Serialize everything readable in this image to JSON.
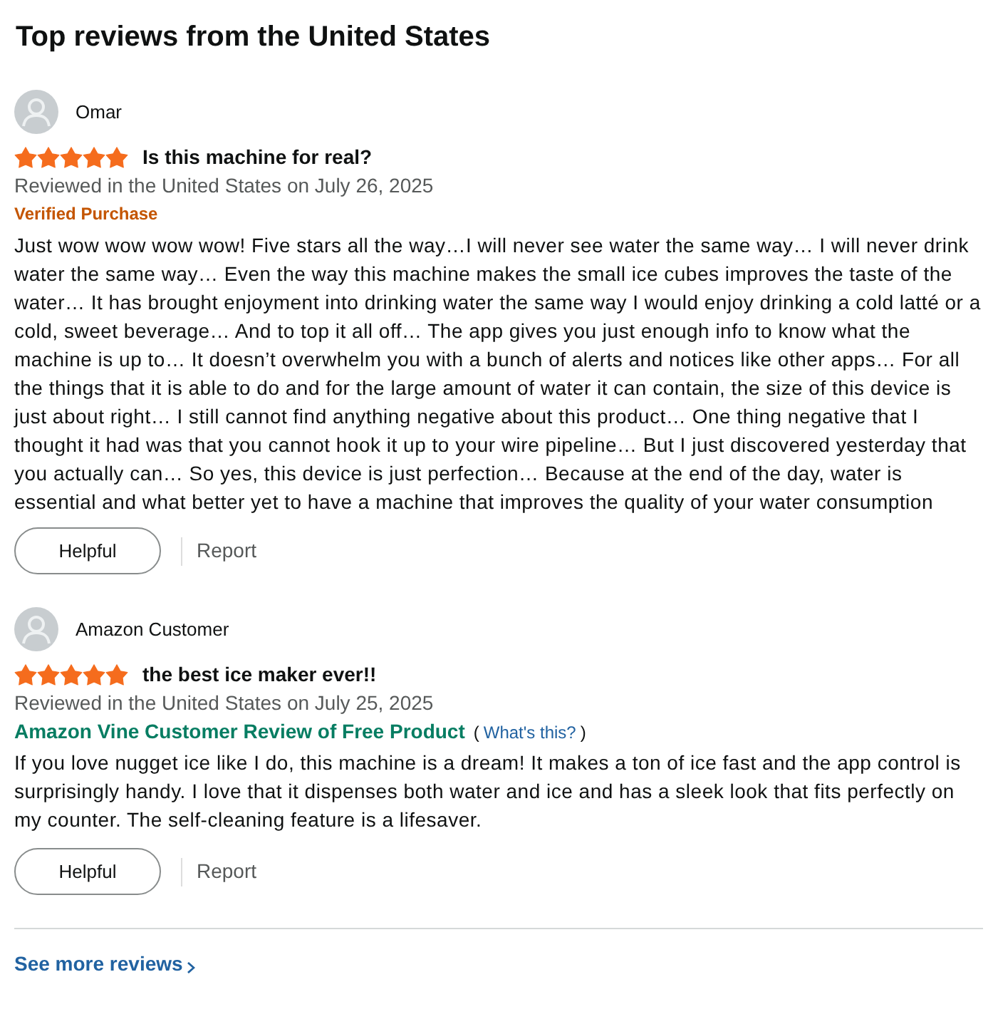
{
  "heading": "Top reviews from the United States",
  "reviews": [
    {
      "author": "Omar",
      "stars": 5,
      "title": "Is this machine for real?",
      "date_line": "Reviewed in the United States on July 26, 2025",
      "badge": {
        "kind": "verified",
        "text": "Verified Purchase"
      },
      "body": "Just wow wow wow wow! Five stars all the way…I will never see water the same way… I will never drink water the same way… Even the way this machine makes the small ice cubes improves the taste of the water… It has brought enjoyment into drinking water the same way I would enjoy drinking a cold latté or a cold, sweet beverage… And to top it all off… The app gives you just enough info to know what the machine is up to… It doesn’t overwhelm you with a bunch of alerts and notices like other apps… For all the things that it is able to do and for the large amount of water it can contain, the size of this device is just about right… I still cannot find anything negative about this product… One thing negative that I thought it had was that you cannot hook it up to your wire pipeline… But I just discovered yesterday that you actually can… So yes, this device is just perfection… Because at the end of the day, water is essential and what better yet to have a machine that improves the quality of your water consumption",
      "helpful_button": "Helpful",
      "report_link": "Report"
    },
    {
      "author": "Amazon Customer",
      "stars": 5,
      "title": "the best ice maker ever!!",
      "date_line": "Reviewed in the United States on July 25, 2025",
      "badge": {
        "kind": "vine",
        "text": "Amazon Vine Customer Review of Free Product",
        "note_open": "(",
        "note_link": "What's this?",
        "note_close": ")"
      },
      "body": "If you love nugget ice like I do, this machine is a dream! It makes a ton of ice fast and the app control is surprisingly handy. I love that it dispenses both water and ice and has a sleek look that fits perfectly on my counter. The self-cleaning feature is a lifesaver.",
      "helpful_button": "Helpful",
      "report_link": "Report"
    }
  ],
  "see_more": {
    "label": "See more reviews"
  }
}
